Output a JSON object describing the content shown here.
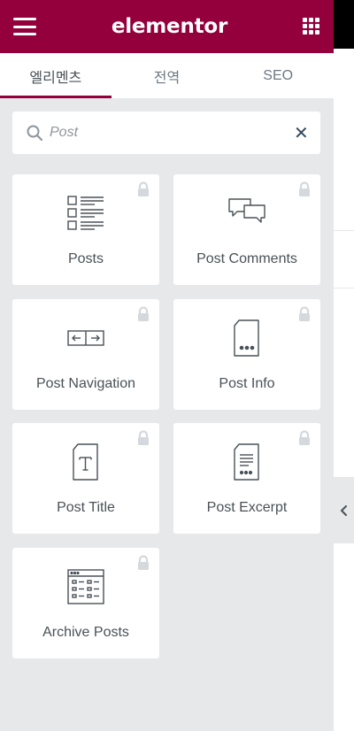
{
  "header": {
    "logo_text": "elementor",
    "brand_color": "#93003c"
  },
  "tabs": [
    {
      "label": "엘리멘츠",
      "active": true
    },
    {
      "label": "전역",
      "active": false
    },
    {
      "label": "SEO",
      "active": false
    }
  ],
  "search": {
    "placeholder": "Post",
    "value": ""
  },
  "widgets": [
    {
      "title": "Posts",
      "icon": "posts-icon",
      "locked": true
    },
    {
      "title": "Post Comments",
      "icon": "post-comments-icon",
      "locked": true
    },
    {
      "title": "Post Navigation",
      "icon": "post-navigation-icon",
      "locked": true
    },
    {
      "title": "Post Info",
      "icon": "post-info-icon",
      "locked": true
    },
    {
      "title": "Post Title",
      "icon": "post-title-icon",
      "locked": true
    },
    {
      "title": "Post Excerpt",
      "icon": "post-excerpt-icon",
      "locked": true
    },
    {
      "title": "Archive Posts",
      "icon": "archive-posts-icon",
      "locked": true
    }
  ]
}
